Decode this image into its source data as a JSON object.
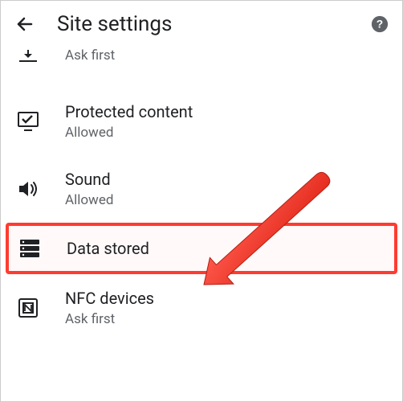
{
  "header": {
    "title": "Site settings"
  },
  "items": [
    {
      "label": "",
      "status": "Ask first",
      "icon": "download-icon"
    },
    {
      "label": "Protected content",
      "status": "Allowed",
      "icon": "protected-content-icon"
    },
    {
      "label": "Sound",
      "status": "Allowed",
      "icon": "sound-icon"
    },
    {
      "label": "Data stored",
      "status": "",
      "icon": "storage-icon"
    },
    {
      "label": "NFC devices",
      "status": "Ask first",
      "icon": "nfc-icon"
    }
  ]
}
